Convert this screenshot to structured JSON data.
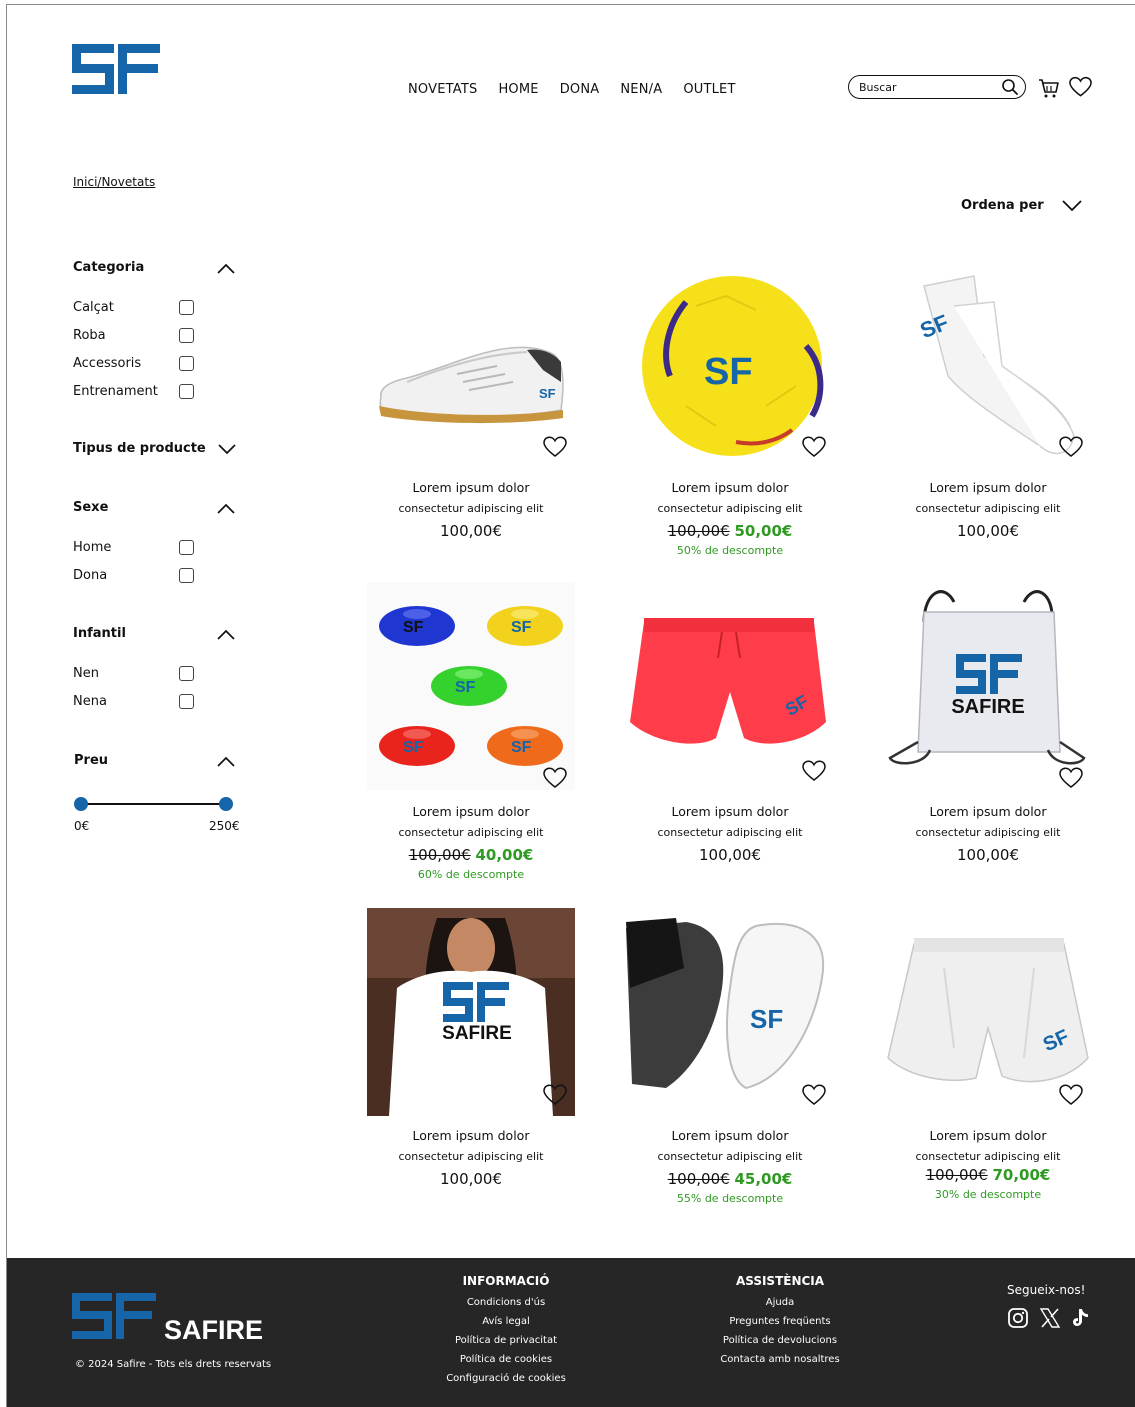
{
  "header": {
    "logo": "SF",
    "nav": [
      "NOVETATS",
      "HOME",
      "DONA",
      "NEN/A",
      "OUTLET"
    ],
    "search_placeholder": "Buscar"
  },
  "breadcrumb": "Inici/Novetats",
  "sort_label": "Ordena per",
  "filters": {
    "categoria": {
      "title": "Categoria",
      "items": [
        "Calçat",
        "Roba",
        "Accessoris",
        "Entrenament"
      ]
    },
    "tipus": {
      "title": "Tipus de producte"
    },
    "sexe": {
      "title": "Sexe",
      "items": [
        "Home",
        "Dona"
      ]
    },
    "infantil": {
      "title": "Infantil",
      "items": [
        "Nen",
        "Nena"
      ]
    },
    "preu": {
      "title": "Preu",
      "min": "0€",
      "max": "250€"
    }
  },
  "products": [
    {
      "name": "Lorem ipsum dolor",
      "desc": "consectetur adipiscing elit",
      "price": "100,00€",
      "old": "",
      "new": "",
      "discount": "",
      "image": "white-futsal-shoe"
    },
    {
      "name": "Lorem ipsum dolor",
      "desc": "consectetur adipiscing elit",
      "price": "",
      "old": "100,00€",
      "new": "50,00€",
      "discount": "50% de descompte",
      "image": "yellow-soccer-ball"
    },
    {
      "name": "Lorem ipsum dolor",
      "desc": "consectetur adipiscing elit",
      "price": "100,00€",
      "old": "",
      "new": "",
      "discount": "",
      "image": "white-socks"
    },
    {
      "name": "Lorem ipsum dolor",
      "desc": "consectetur adipiscing elit",
      "price": "",
      "old": "100,00€",
      "new": "40,00€",
      "discount": "60% de descompte",
      "image": "training-cones"
    },
    {
      "name": "Lorem ipsum dolor",
      "desc": "consectetur adipiscing elit",
      "price": "100,00€",
      "old": "",
      "new": "",
      "discount": "",
      "image": "red-shorts"
    },
    {
      "name": "Lorem ipsum dolor",
      "desc": "consectetur adipiscing elit",
      "price": "100,00€",
      "old": "",
      "new": "",
      "discount": "",
      "image": "drawstring-bag",
      "brand_text": "SAFIRE"
    },
    {
      "name": "Lorem ipsum dolor",
      "desc": "consectetur adipiscing elit",
      "price": "100,00€",
      "old": "",
      "new": "",
      "discount": "",
      "image": "white-tshirt",
      "brand_text": "SAFIRE"
    },
    {
      "name": "Lorem ipsum dolor",
      "desc": "consectetur adipiscing elit",
      "price": "",
      "old": "100,00€",
      "new": "45,00€",
      "discount": "55% de descompte",
      "image": "shin-guards"
    },
    {
      "name": "Lorem ipsum dolor",
      "desc": "consectetur adipiscing elit",
      "price": "",
      "old": "100,00€",
      "new": "70,00€",
      "discount": "30% de descompte",
      "image": "white-shorts"
    }
  ],
  "footer": {
    "brand": "SAFIRE",
    "copyright": "© 2024 Safire - Tots els drets reservats",
    "info": {
      "title": "INFORMACIÓ",
      "links": [
        "Condicions d'ús",
        "Avís legal",
        "Política de privacitat",
        "Política de cookies",
        "Configuració de cookies"
      ]
    },
    "assist": {
      "title": "ASSISTÈNCIA",
      "links": [
        "Ajuda",
        "Preguntes freqüents",
        "Política de devolucions",
        "Contacta amb nosaltres"
      ]
    },
    "follow": "Segueix-nos!",
    "social": [
      "instagram-icon",
      "x-icon",
      "tiktok-icon"
    ]
  },
  "colors": {
    "brand_blue": "#1565a8",
    "discount_green": "#2f9a22",
    "footer_bg": "#262626"
  }
}
